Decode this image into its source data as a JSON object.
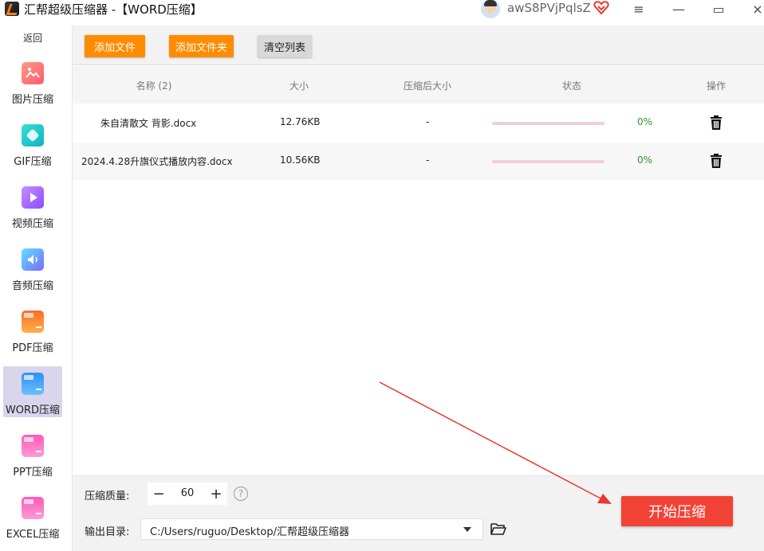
{
  "window": {
    "title": "汇帮超级压缩器  -【WORD压缩】",
    "user_name": "awS8PVjPqlsZ",
    "icons": [
      "app-logo-icon",
      "avatar",
      "vip-heart-icon",
      "menu-icon",
      "minimize-icon",
      "maximize-icon",
      "close-icon"
    ],
    "buttons": {
      "menu": "≡",
      "minimize": "—",
      "maximize": "▭",
      "close": "×"
    }
  },
  "sidebar": {
    "back_label": "返回",
    "items": [
      {
        "label": "图片压缩",
        "icon": "image-compress-icon",
        "color": "#ff6b6b"
      },
      {
        "label": "GIF压缩",
        "icon": "gif-compress-icon",
        "color": "#12c6c6"
      },
      {
        "label": "视频压缩",
        "icon": "video-compress-icon",
        "color": "#a05cff"
      },
      {
        "label": "音频压缩",
        "icon": "audio-compress-icon",
        "color": "#4aa3ff"
      },
      {
        "label": "PDF压缩",
        "icon": "pdf-compress-icon",
        "color": "#ff8c2a"
      },
      {
        "label": "WORD压缩",
        "icon": "word-compress-icon",
        "color": "#3c8df2",
        "active": true
      },
      {
        "label": "PPT压缩",
        "icon": "ppt-compress-icon",
        "color": "#ff6ec7"
      },
      {
        "label": "EXCEL压缩",
        "icon": "excel-compress-icon",
        "color": "#ff6ec7"
      }
    ]
  },
  "toolbar": {
    "add_file_label": "添加文件",
    "add_folder_label": "添加文件夹",
    "clear_list_label": "清空列表"
  },
  "table": {
    "headers": {
      "name": "名称 (2)",
      "size": "大小",
      "compressed_size": "压缩后大小",
      "status": "状态",
      "action": "操作"
    },
    "rows": [
      {
        "name": "朱自清散文     背影.docx",
        "size": "12.76KB",
        "compressed_size": "-",
        "progress": 0,
        "progress_text": "0%"
      },
      {
        "name": "2024.4.28升旗仪式播放内容.docx",
        "size": "10.56KB",
        "compressed_size": "-",
        "progress": 0,
        "progress_text": "0%"
      }
    ]
  },
  "settings": {
    "quality_label": "压缩质量:",
    "quality_value": "60",
    "decrement": "−",
    "increment": "+",
    "help": "?",
    "output_label": "输出目录:",
    "output_path": "C:/Users/ruguo/Desktop/汇帮超级压缩器"
  },
  "actions": {
    "start_label": "开始压缩"
  },
  "colors": {
    "accent_orange": "#ff8c00",
    "start_red": "#f24236",
    "progress_green": "#2a9a2a",
    "progress_track": "#f2cdd8",
    "active_nav": "#d9d5ec",
    "annotation_arrow": "#e8382f"
  }
}
